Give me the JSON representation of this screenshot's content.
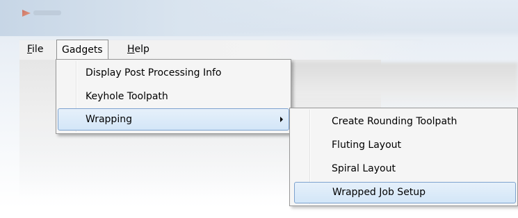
{
  "window": {
    "app_icon": "app-logo-icon"
  },
  "menubar": {
    "file_mnemonic": "F",
    "file_rest": "ile",
    "gadgets_label": "Gadgets",
    "help_mnemonic": "H",
    "help_rest": "elp"
  },
  "gadgets_menu": {
    "items": [
      {
        "label": "Display Post Processing Info"
      },
      {
        "label": "Keyhole Toolpath"
      },
      {
        "label": "Wrapping",
        "has_submenu": true,
        "submenu_icon": "chevron-right-icon"
      }
    ]
  },
  "wrapping_submenu": {
    "items": [
      {
        "label": "Create Rounding Toolpath"
      },
      {
        "label": "Fluting Layout"
      },
      {
        "label": "Spiral Layout"
      },
      {
        "label": "Wrapped Job Setup"
      }
    ]
  },
  "colors": {
    "highlight_border": "#7da2ce",
    "highlight_fill": "#d3e6f8",
    "menu_bg": "#f5f5f5"
  }
}
